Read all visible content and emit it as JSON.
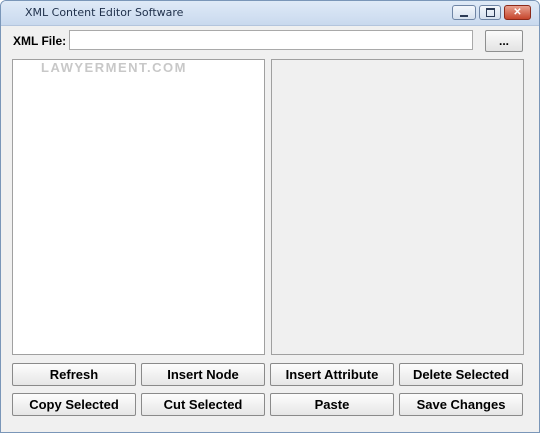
{
  "window": {
    "title": "XML Content Editor Software",
    "minimize_label": "",
    "maximize_label": "",
    "close_label": "✕"
  },
  "file": {
    "label": "XML File:",
    "value": "",
    "browse_label": "..."
  },
  "watermark": "LAWYERMENT.COM",
  "buttons": {
    "refresh": "Refresh",
    "insert_node": "Insert Node",
    "insert_attribute": "Insert Attribute",
    "delete_selected": "Delete Selected",
    "copy_selected": "Copy Selected",
    "cut_selected": "Cut Selected",
    "paste": "Paste",
    "save_changes": "Save Changes"
  }
}
